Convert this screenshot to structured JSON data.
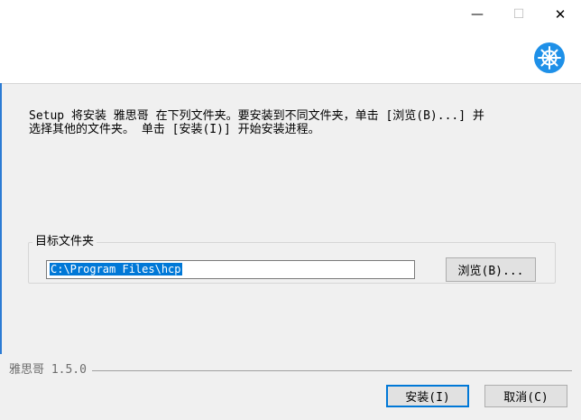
{
  "window": {
    "minimize_glyph": "—",
    "maximize_glyph": "☐",
    "close_glyph": "✕"
  },
  "header": {
    "logo_icon": "ship-wheel-icon",
    "accent_color": "#1e90e8"
  },
  "main": {
    "description": "Setup 将安装 雅思哥 在下列文件夹。要安装到不同文件夹，单击 [浏览(B)...] 并\n选择其他的文件夹。 单击 [安装(I)] 开始安装进程。",
    "group_label": "目标文件夹",
    "install_path": "C:\\Program Files\\hcp",
    "browse_label": "浏览(B)..."
  },
  "footer": {
    "brand_label": "雅思哥 1.5.0",
    "install_label": "安装(I)",
    "cancel_label": "取消(C)"
  }
}
